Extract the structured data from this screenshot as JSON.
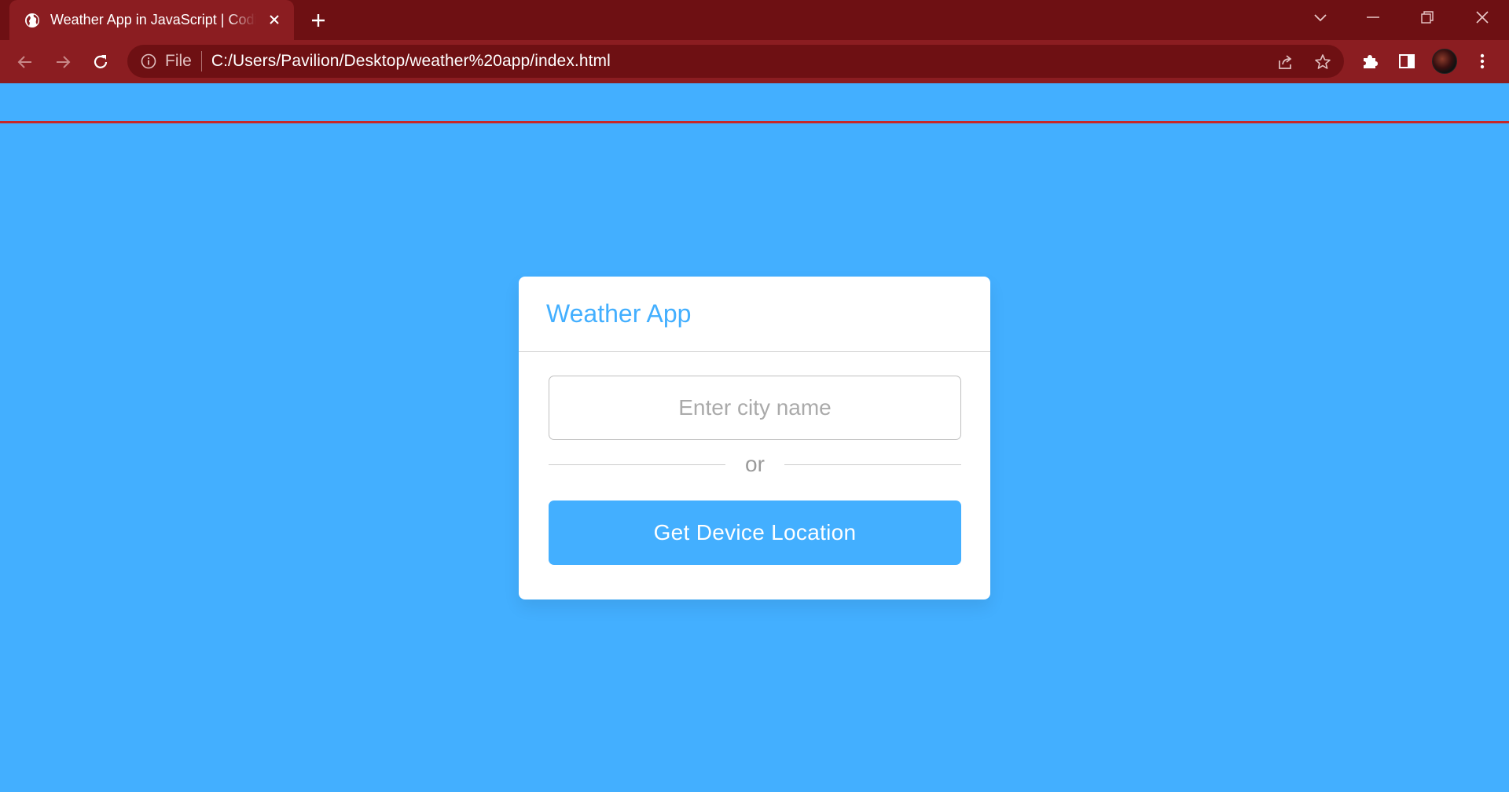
{
  "browser": {
    "tab_title": "Weather App in JavaScript | Coding",
    "omnibox": {
      "scheme_label": "File",
      "url": "C:/Users/Pavilion/Desktop/weather%20app/index.html"
    },
    "colors": {
      "titlebar": "#6e1013",
      "toolbar": "#8b1d21"
    }
  },
  "page": {
    "background": "#43afff",
    "card": {
      "title": "Weather App",
      "city_input": {
        "value": "",
        "placeholder": "Enter city name"
      },
      "divider_text": "or",
      "location_button_label": "Get Device Location"
    }
  }
}
